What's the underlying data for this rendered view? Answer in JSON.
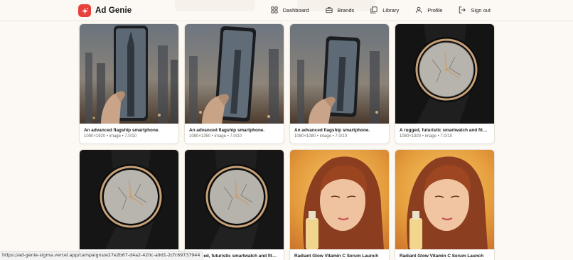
{
  "app": {
    "name": "Ad Genie"
  },
  "nav": [
    {
      "label": "Dashboard",
      "icon": "grid-icon"
    },
    {
      "label": "Brands",
      "icon": "briefcase-icon"
    },
    {
      "label": "Library",
      "icon": "library-icon"
    },
    {
      "label": "Profile",
      "icon": "user-icon"
    },
    {
      "label": "Sign out",
      "icon": "sign-out-icon"
    }
  ],
  "cards": [
    {
      "caption": "An advanced flagship smartphone.",
      "meta": "1080×1920 • image • 7.0/10",
      "thumb": "phone-tall"
    },
    {
      "caption": "An advanced flagship smartphone.",
      "meta": "1080×1350 • image • 7.0/10",
      "thumb": "phone-hand"
    },
    {
      "caption": "An advanced flagship smartphone.",
      "meta": "1080×1080 • image • 7.0/10",
      "thumb": "phone-hand"
    },
    {
      "caption": "A rugged, futuristic smartwatch and fitnes...",
      "meta": "1080×1920 • image • 7.0/10",
      "thumb": "watch"
    },
    {
      "caption": "",
      "meta": "",
      "thumb": "watch"
    },
    {
      "caption": "A rugged, futuristic smartwatch and fitnes...",
      "meta": "",
      "thumb": "watch"
    },
    {
      "caption": "Radiant Glow Vitamin C Serum Launch",
      "meta": "",
      "thumb": "serum"
    },
    {
      "caption": "Radiant Glow Vitamin C Serum Launch",
      "meta": "",
      "thumb": "serum"
    }
  ],
  "status_bar": {
    "url": "https://ad-genie-sigma.vercel.app/campaigns/e27e2b67-d4a2-420c-a9d1-2cfc69737944"
  },
  "colors": {
    "brand": "#e8413a",
    "background": "#fcf8f3",
    "card": "#ffffff",
    "muted_text": "#6f6a63"
  }
}
